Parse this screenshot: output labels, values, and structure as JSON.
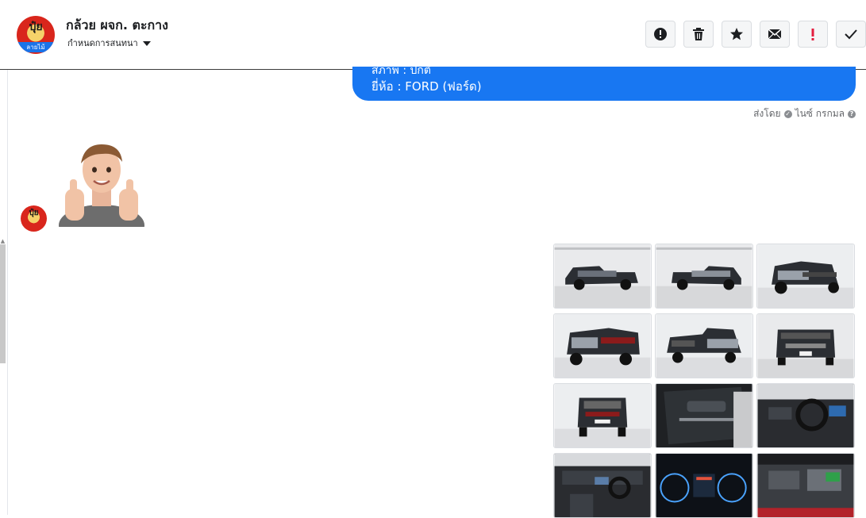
{
  "header": {
    "contact_name": "กล้วย ผจก. ตะกาง",
    "assign_label": "กำหนดการสนทนา",
    "avatar_text": "ปุ๋ย",
    "avatar_subtext": "ลายไม้",
    "tools": [
      {
        "icon": "alert-circle-icon",
        "name": "mark-spam-button"
      },
      {
        "icon": "trash-icon",
        "name": "delete-button"
      },
      {
        "icon": "star-icon",
        "name": "star-button"
      },
      {
        "icon": "envelope-icon",
        "name": "mark-unread-button"
      },
      {
        "icon": "exclamation-icon",
        "name": "mark-important-button"
      },
      {
        "icon": "check-icon",
        "name": "mark-done-button"
      }
    ]
  },
  "message": {
    "hidden_line": "สภาพ : ปกติ",
    "brand_line": "ยี่ห้อ : FORD (ฟอร์ด)",
    "sent_by_label": "ส่งโดย",
    "sent_by_name": "ไนซ์ กรกมล"
  },
  "sticker": {
    "icon": "thumbs-up-avatar-sticker"
  },
  "gallery": {
    "count": 12,
    "items": [
      "truck-left-side-photo",
      "truck-right-side-photo",
      "truck-rear-angle-photo",
      "truck-front-angle-photo",
      "truck-rear-three-quarter-photo",
      "truck-rear-photo",
      "truck-front-photo",
      "truck-door-panel-photo",
      "truck-dashboard-photo",
      "truck-interior-wide-photo",
      "truck-gauge-cluster-photo",
      "truck-engine-bay-photo"
    ]
  },
  "colors": {
    "accent": "#1877f2",
    "important": "#e41e3f"
  }
}
